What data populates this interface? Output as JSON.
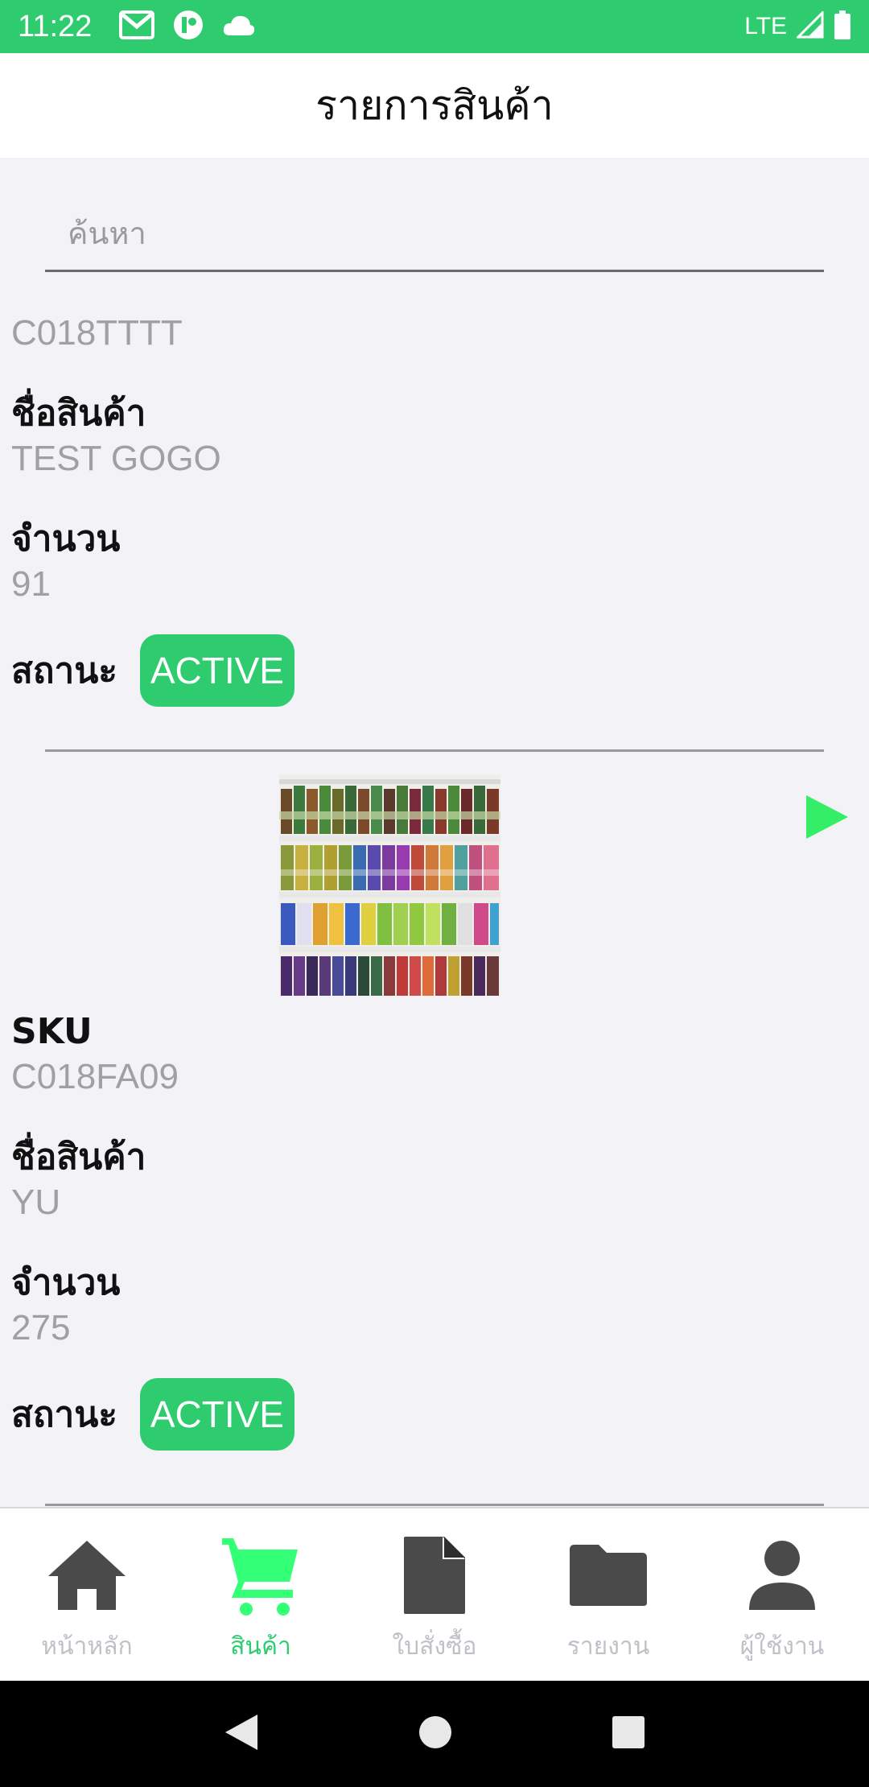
{
  "status_bar": {
    "time": "11:22",
    "network": "LTE",
    "icons_left": [
      "gmail-icon",
      "app-notification-icon",
      "cloud-icon"
    ],
    "icons_right": [
      "signal-icon",
      "battery-icon"
    ]
  },
  "header": {
    "title": "รายการสินค้า"
  },
  "search": {
    "placeholder": "ค้นหา",
    "value": ""
  },
  "products": [
    {
      "sku": "C018TTTT",
      "name_label": "ชื่อสินค้า",
      "name": "TEST GOGO",
      "qty_label": "จำนวน",
      "qty": "91",
      "status_label": "สถานะ",
      "status": "ACTIVE"
    },
    {
      "image": "shelf-bottles-image",
      "sku_label": "SKU",
      "sku": "C018FA09",
      "name_label": "ชื่อสินค้า",
      "name": "YU",
      "qty_label": "จำนวน",
      "qty": "275",
      "status_label": "สถานะ",
      "status": "ACTIVE"
    }
  ],
  "bottom_nav": {
    "items": [
      {
        "label": "หน้าหลัก",
        "icon": "home-icon",
        "active": false
      },
      {
        "label": "สินค้า",
        "icon": "cart-icon",
        "active": true
      },
      {
        "label": "ใบสั่งซื้อ",
        "icon": "document-icon",
        "active": false
      },
      {
        "label": "รายงาน",
        "icon": "folder-icon",
        "active": false
      },
      {
        "label": "ผู้ใช้งาน",
        "icon": "user-icon",
        "active": false
      }
    ]
  },
  "colors": {
    "accent": "#2ecc6f",
    "active_nav": "#33ff77",
    "icon_dark": "#4a4a4a",
    "inactive_label": "#c0c0c8"
  }
}
